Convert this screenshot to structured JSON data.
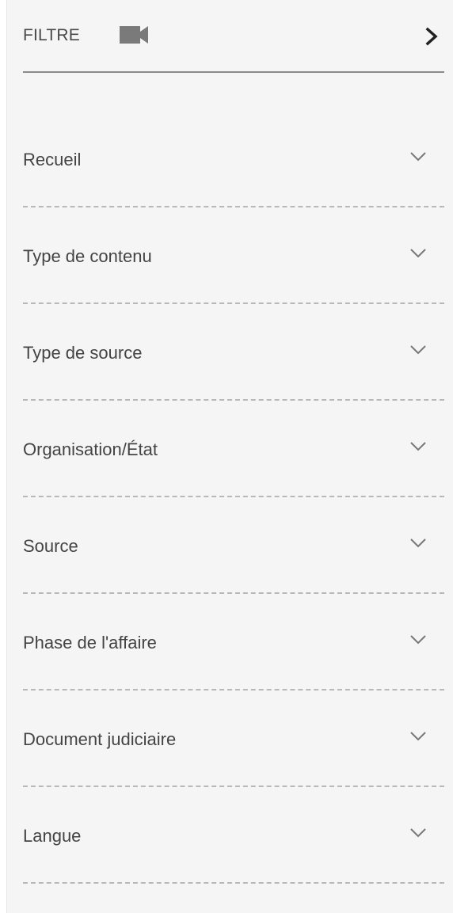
{
  "header": {
    "title": "FILTRE",
    "icon": "video-camera-icon",
    "collapse_icon": "chevron-right-icon"
  },
  "filters": [
    {
      "label": "Recueil"
    },
    {
      "label": "Type de contenu"
    },
    {
      "label": "Type de source"
    },
    {
      "label": "Organisation/État"
    },
    {
      "label": "Source"
    },
    {
      "label": "Phase de l'affaire"
    },
    {
      "label": "Document judiciaire"
    },
    {
      "label": "Langue"
    }
  ],
  "colors": {
    "panel_bg": "#f5f5f5",
    "text": "#444444",
    "divider": "#b8b8b8"
  }
}
